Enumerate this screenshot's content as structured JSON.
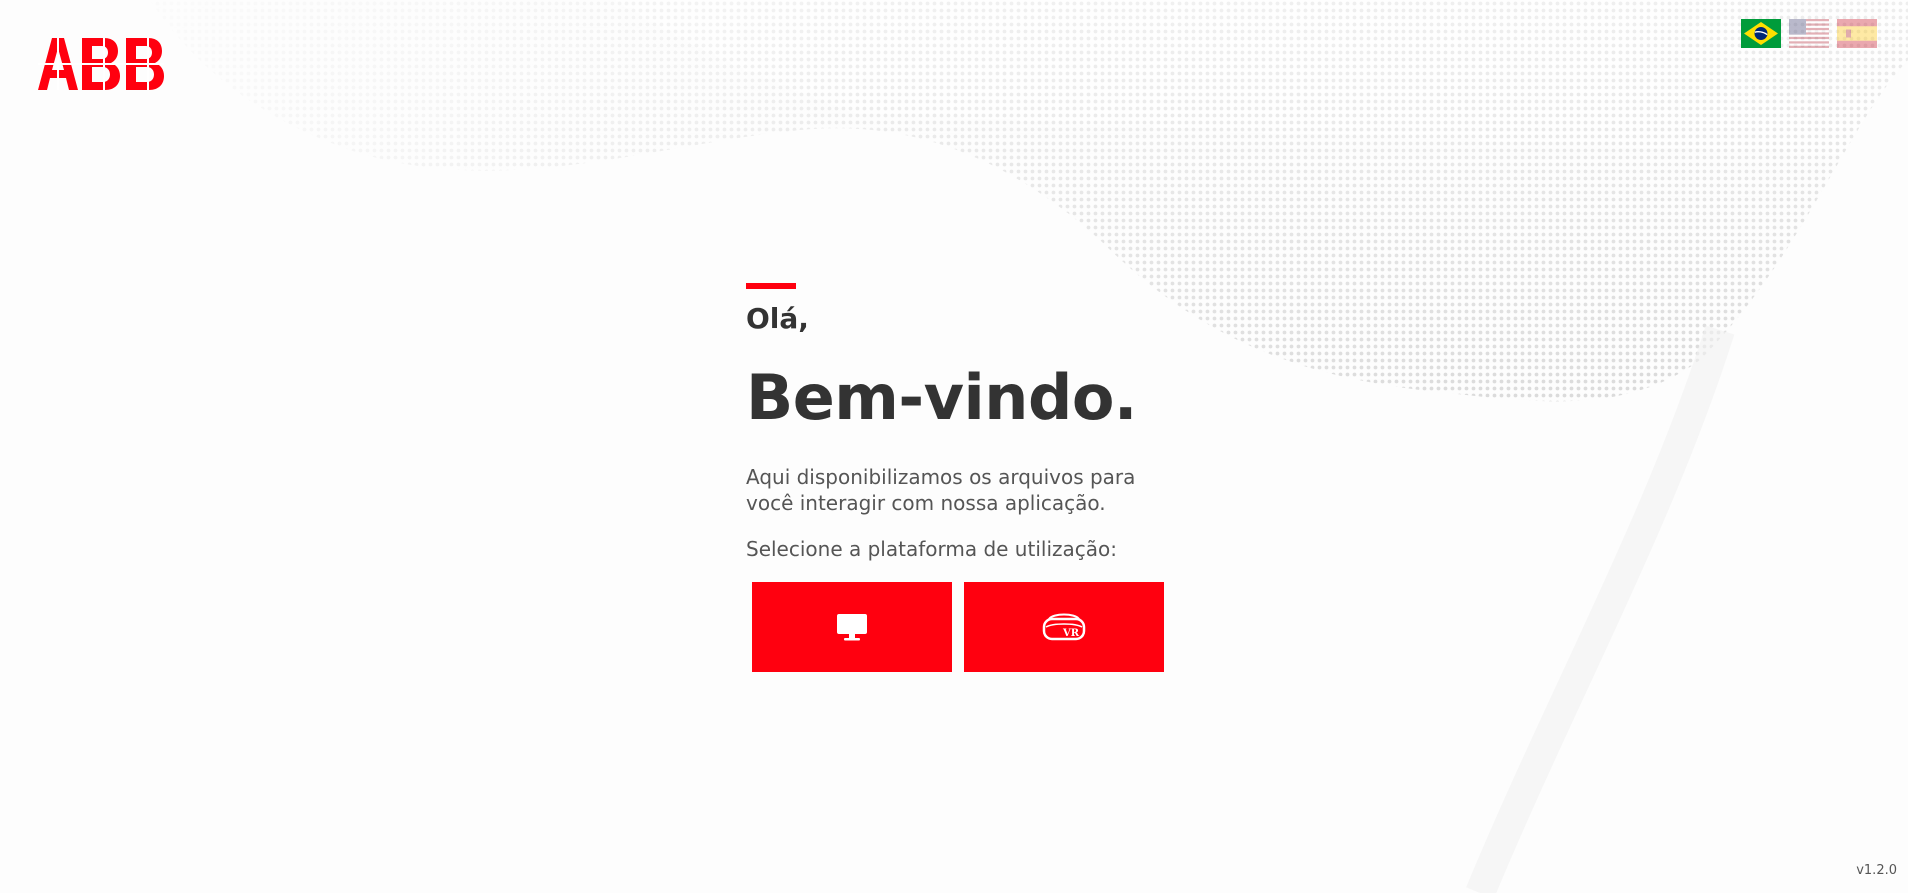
{
  "brand": {
    "logo_text": "ABB",
    "accent_color": "#ff000f"
  },
  "languages": [
    {
      "code": "pt-BR",
      "icon": "brazil-flag-icon",
      "active": true
    },
    {
      "code": "en-US",
      "icon": "usa-flag-icon",
      "active": false
    },
    {
      "code": "es",
      "icon": "spain-flag-icon",
      "active": false
    }
  ],
  "main": {
    "greeting": "Olá,",
    "welcome": "Bem-vindo.",
    "description": "Aqui disponibilizamos os arquivos para você interagir com nossa aplicação.",
    "select_prompt": "Selecione a plataforma de utilização:",
    "platforms": [
      {
        "icon": "desktop-monitor-icon"
      },
      {
        "icon": "vr-headset-icon",
        "icon_text": "VR"
      }
    ]
  },
  "footer": {
    "version": "v1.2.0"
  }
}
